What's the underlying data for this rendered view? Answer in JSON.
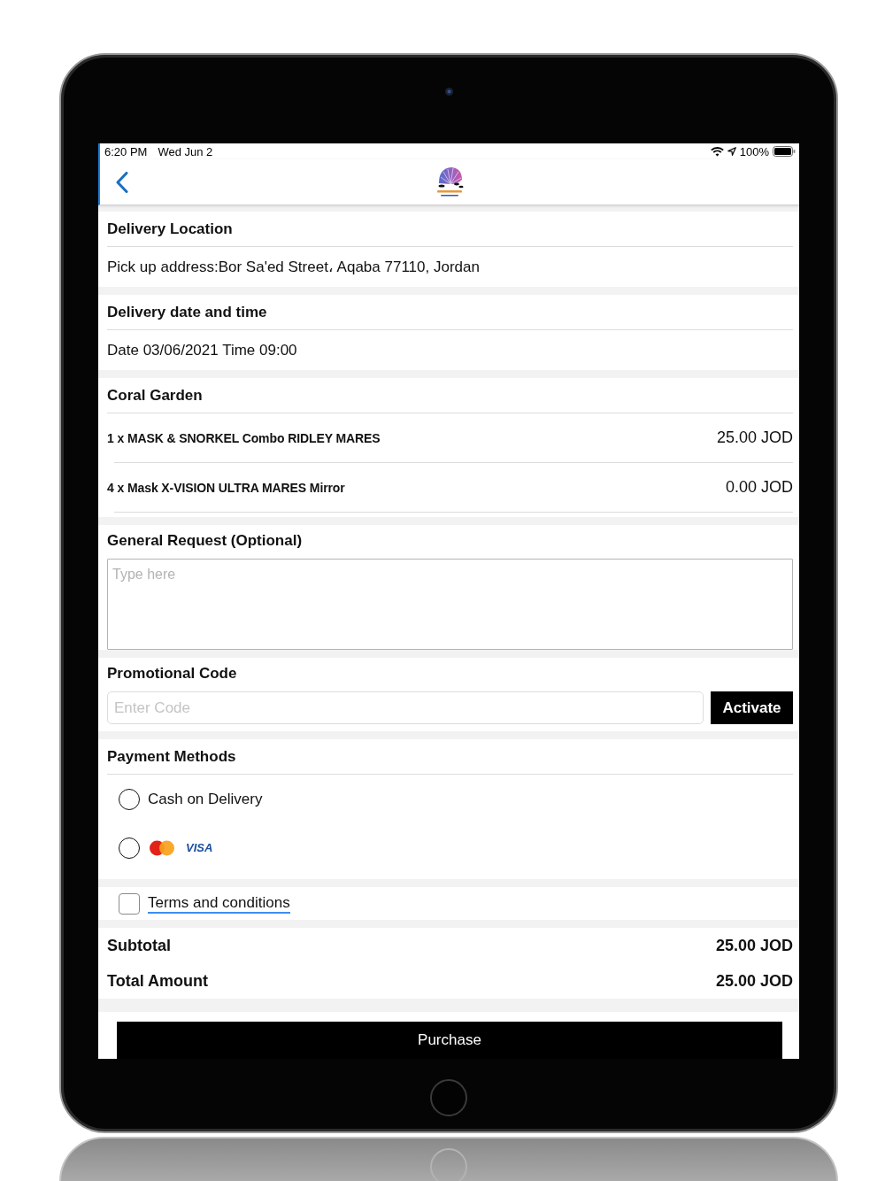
{
  "status_bar": {
    "time": "6:20 PM",
    "date": "Wed Jun 2",
    "battery": "100%"
  },
  "sections": [
    {
      "kind": "info",
      "title": "Delivery Location",
      "text": "Pick up address:Bor Sa'ed Street، Aqaba 77110, Jordan"
    },
    {
      "kind": "info",
      "title": "Delivery date and time",
      "text": "Date 03/06/2021 Time 09:00"
    },
    {
      "kind": "items",
      "title": "Coral Garden",
      "items": [
        {
          "name": "1 x MASK & SNORKEL Combo RIDLEY MARES",
          "price": "25.00 JOD"
        },
        {
          "name": "4 x Mask X-VISION ULTRA MARES Mirror",
          "price": "0.00 JOD"
        }
      ]
    },
    {
      "kind": "textarea",
      "title": "General Request (Optional)",
      "placeholder": "Type here"
    },
    {
      "kind": "promo",
      "title": "Promotional Code",
      "placeholder": "Enter Code",
      "button": "Activate"
    },
    {
      "kind": "payment",
      "title": "Payment Methods",
      "options": [
        {
          "kind": "text",
          "label": "Cash on Delivery",
          "selected": false
        },
        {
          "kind": "cards",
          "label": "VISA",
          "selected": false
        }
      ]
    },
    {
      "kind": "terms",
      "label": "Terms and conditions",
      "checked": false
    },
    {
      "kind": "totals",
      "rows": [
        {
          "label": "Subtotal",
          "value": "25.00 JOD"
        },
        {
          "label": "Total Amount",
          "value": "25.00 JOD"
        }
      ]
    }
  ],
  "purchase_button": {
    "label": "Purchase"
  }
}
